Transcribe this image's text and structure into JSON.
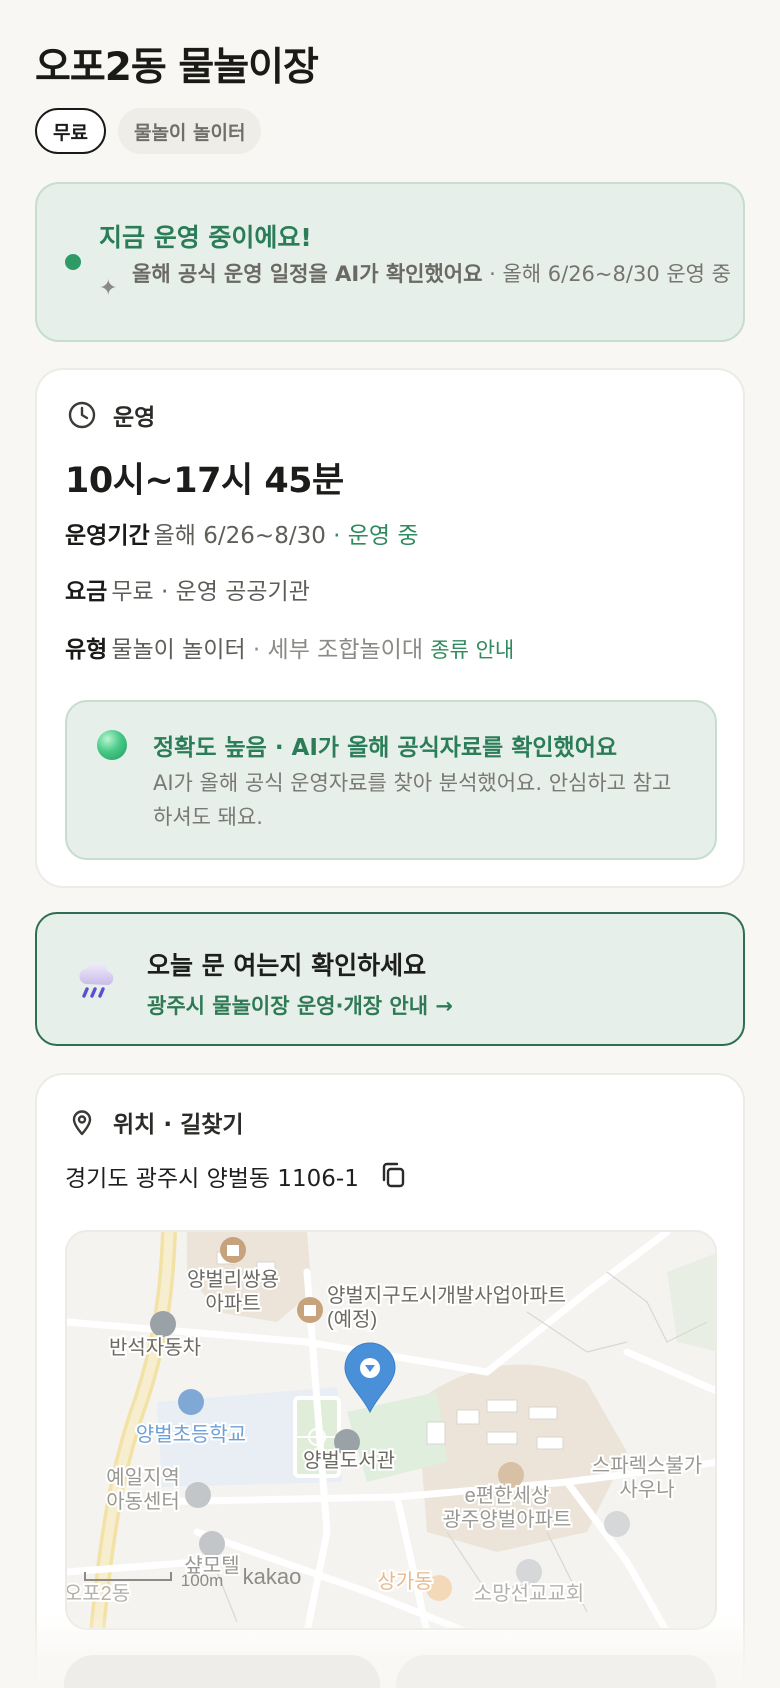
{
  "page": {
    "title": "오포2동 물놀이장",
    "tags": [
      "무료",
      "물놀이 놀이터"
    ]
  },
  "status": {
    "title": "지금 운영 중이에요!",
    "ai_note": "올해 공식 운영 일정을 AI가 확인했어요",
    "schedule": " · 올해 6/26~8/30 운영 중",
    "dot_color": "#2e9a66"
  },
  "operation": {
    "section_label": "운영",
    "section_icon": "clock-icon",
    "hours": "10시~17시 45분",
    "period_label": "운영기간",
    "period_value": "올해 6/26~8/30",
    "period_status": " · 운영 중",
    "fee_label": "요금",
    "fee_value": "무료 · 운영 공공기관",
    "type_label": "유형",
    "type_value": "물놀이 놀이터",
    "type_detail": " · 세부 조합놀이대",
    "type_guide": "종류 안내",
    "accuracy": {
      "title": "정확도 높음 · AI가 올해 공식자료를 확인했어요",
      "desc": "AI가 올해 공식 운영자료를 찾아 분석했어요. 안심하고 참고하셔도 돼요."
    }
  },
  "notice": {
    "icon": "rain-cloud-icon",
    "title": "오늘 문 여는지 확인하세요",
    "link": "광주시 물놀이장 운영·개장 안내 →"
  },
  "location": {
    "section_label": "위치 · 길찾기",
    "section_icon": "map-pin-icon",
    "address": "경기도 광주시 양벌동 1106-1",
    "copy_icon": "copy-icon",
    "map_labels": {
      "apt1_line1": "양벌리쌍용",
      "apt1_line2": "아파트",
      "apt2_line1": "양벌지구도시개발사업아파트",
      "apt2_line2": "(예정)",
      "garage": "반석자동차",
      "school": "양벌초등학교",
      "library": "양벌도서관",
      "center_line1": "예일지역",
      "center_line2": "아동센터",
      "sauna_line1": "스파렉스불가",
      "sauna_line2": "사우나",
      "apt3_line1": "e편한세상",
      "apt3_line2": "광주양벌아파트",
      "motel": "샾모텔",
      "scale": "100m",
      "brand": "kakao",
      "town": "오포2동",
      "market": "상가동",
      "church": "소망선교교회"
    },
    "accent": "#4a90d9"
  }
}
